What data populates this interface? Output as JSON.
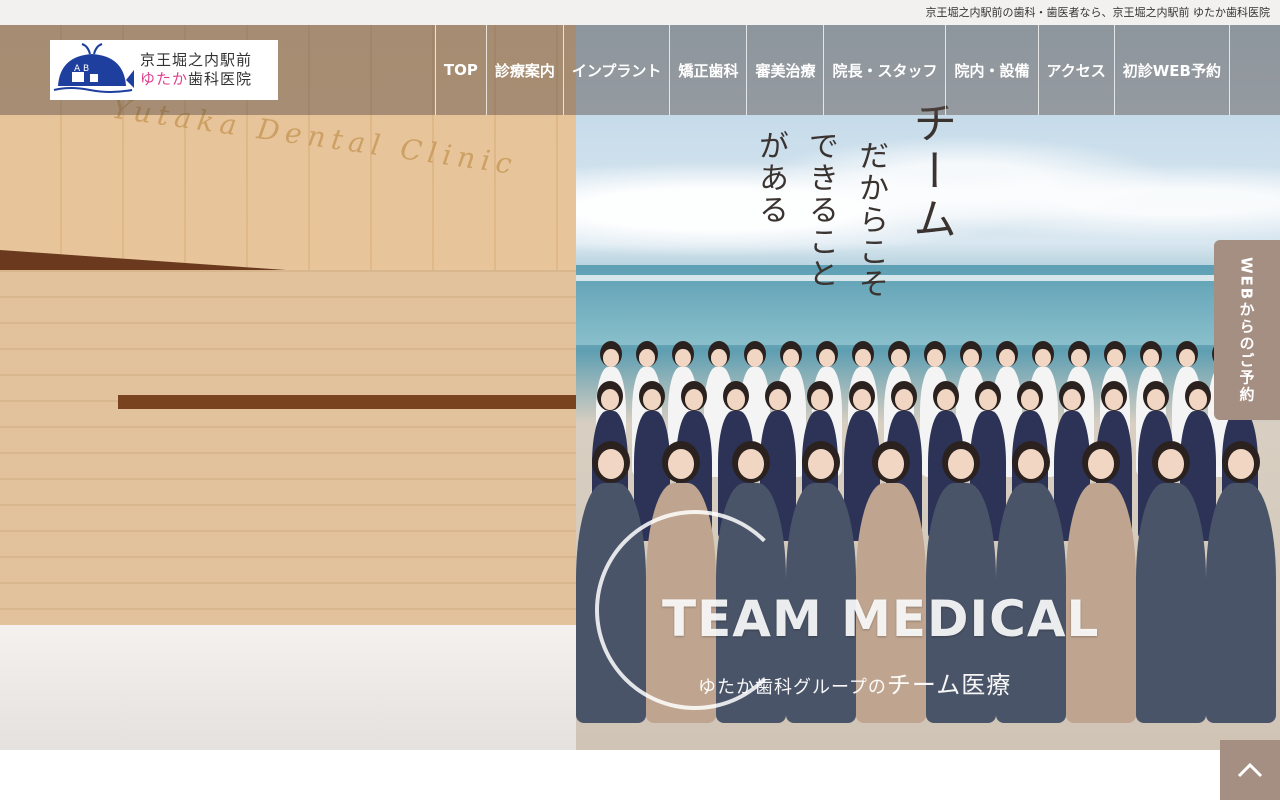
{
  "topbar": {
    "text": "京王堀之内駅前の歯科・歯医者なら、京王堀之内駅前 ゆたか歯科医院"
  },
  "logo": {
    "line1": "京王堀之内駅前",
    "line2_pink": "ゆたか",
    "line2_dark": "歯科医院",
    "mark_letters": "A B"
  },
  "nav": [
    {
      "label": "TOP"
    },
    {
      "label": "診療案内"
    },
    {
      "label": "インプラント"
    },
    {
      "label": "矯正歯科"
    },
    {
      "label": "審美治療"
    },
    {
      "label": "院長・スタッフ"
    },
    {
      "label": "院内・設備"
    },
    {
      "label": "アクセス"
    },
    {
      "label": "初診WEB予約"
    }
  ],
  "hero": {
    "wall_sign": "Yutaka Dental Clinic",
    "slogan": [
      "チーム",
      "だからこそ",
      "できること",
      "がある"
    ],
    "team_title": "TEAM MEDICAL",
    "team_sub_small": "ゆたか歯科グループの",
    "team_sub_big": "チーム医療"
  },
  "side_reserve": {
    "label": "WEBからのご予約"
  },
  "colors": {
    "accent": "#a58f82",
    "header_overlay": "#584c44",
    "logo_pink": "#e0438e",
    "logo_blue": "#1f3f9e"
  },
  "icons": {
    "to_top": "chevron-up-icon"
  }
}
